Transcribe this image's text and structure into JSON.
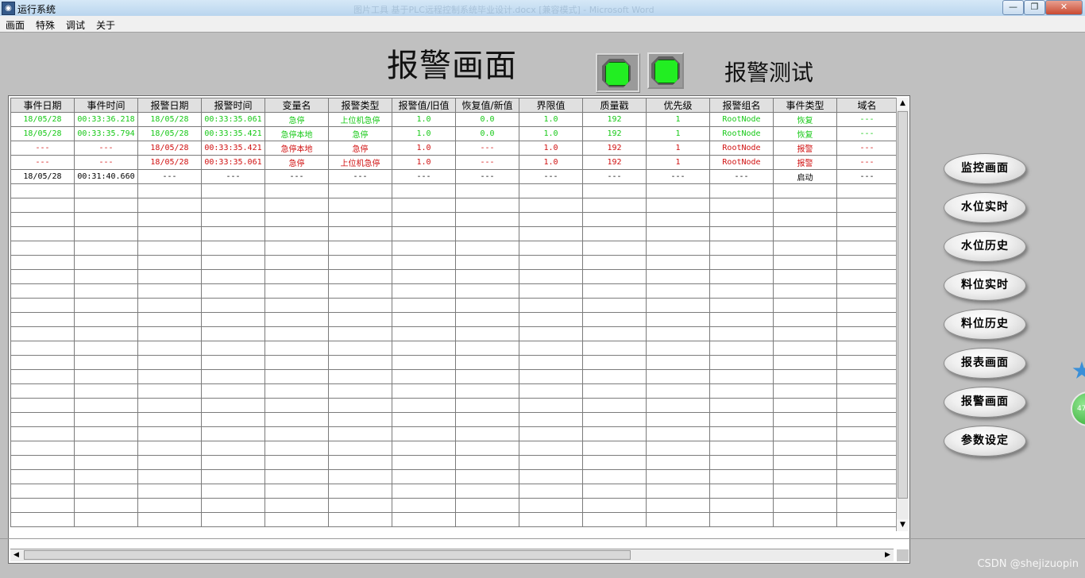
{
  "window": {
    "title": "运行系统",
    "background_title": "图片工具  基于PLC远程控制系统毕业设计.docx [兼容模式] - Microsoft Word",
    "controls": [
      "—",
      "❐",
      "✕"
    ]
  },
  "menu": [
    "画面",
    "特殊",
    "调试",
    "关于"
  ],
  "screen": {
    "title": "报警画面",
    "test_label": "报警测试",
    "lamp_color": "#22ee22"
  },
  "table": {
    "columns": [
      "事件日期",
      "事件时间",
      "报警日期",
      "报警时间",
      "变量名",
      "报警类型",
      "报警值/旧值",
      "恢复值/新值",
      "界限值",
      "质量戳",
      "优先级",
      "报警组名",
      "事件类型",
      "域名"
    ],
    "rows": [
      {
        "color": "green",
        "cells": [
          "18/05/28",
          "00:33:36.218",
          "18/05/28",
          "00:33:35.061",
          "急停",
          "上位机急停",
          "1.0",
          "0.0",
          "1.0",
          "192",
          "1",
          "RootNode",
          "恢复",
          "---"
        ]
      },
      {
        "color": "green",
        "cells": [
          "18/05/28",
          "00:33:35.794",
          "18/05/28",
          "00:33:35.421",
          "急停本地",
          "急停",
          "1.0",
          "0.0",
          "1.0",
          "192",
          "1",
          "RootNode",
          "恢复",
          "---"
        ]
      },
      {
        "color": "red",
        "cells": [
          "---",
          "---",
          "18/05/28",
          "00:33:35.421",
          "急停本地",
          "急停",
          "1.0",
          "---",
          "1.0",
          "192",
          "1",
          "RootNode",
          "报警",
          "---"
        ]
      },
      {
        "color": "red",
        "cells": [
          "---",
          "---",
          "18/05/28",
          "00:33:35.061",
          "急停",
          "上位机急停",
          "1.0",
          "---",
          "1.0",
          "192",
          "1",
          "RootNode",
          "报警",
          "---"
        ]
      },
      {
        "color": "black",
        "cells": [
          "18/05/28",
          "00:31:40.660",
          "---",
          "---",
          "---",
          "---",
          "---",
          "---",
          "---",
          "---",
          "---",
          "---",
          "启动",
          "---"
        ]
      }
    ],
    "empty_rows": 24
  },
  "colors": {
    "green": "#15c815",
    "red": "#d01010",
    "black": "#000000"
  },
  "nav_buttons": [
    "监控画面",
    "水位实时",
    "水位历史",
    "料位实时",
    "料位历史",
    "报表画面",
    "报警画面",
    "参数设定"
  ],
  "floating_widget": {
    "badge": "47"
  },
  "watermark": "CSDN @shejizuopin"
}
